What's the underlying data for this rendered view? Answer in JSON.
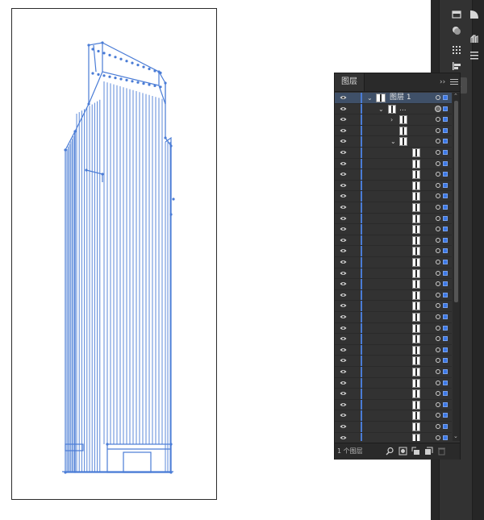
{
  "panel": {
    "tab_label": "图层",
    "collapse_icon": "double-chevron-right-icon",
    "menu_icon": "panel-menu-icon",
    "layer_count": "1 个图层",
    "footer_icons": [
      "locate-object-icon",
      "make-clipping-mask-icon",
      "create-sublayer-icon",
      "new-layer-icon",
      "delete-icon"
    ]
  },
  "rows": [
    {
      "kind": "layer",
      "name": "图层 1",
      "selected": true
    },
    {
      "kind": "group",
      "name": "..."
    },
    {
      "kind": "sub-collapsed"
    },
    {
      "kind": "sub-plain"
    },
    {
      "kind": "sub-expanded"
    }
  ],
  "path_row_count": 27,
  "toolstrip": {
    "icons": [
      "artboards-icon",
      "appearance-icon",
      "pathfinder-icon",
      "puppet-warp-icon",
      "grid-icon",
      "align-icon",
      "distribute-icon",
      "layers-icon"
    ]
  },
  "colors": {
    "accent": "#3b78e7",
    "path_stroke": "#4a7cd6",
    "panel_bg": "#323232",
    "toolbar_bg": "#262626"
  }
}
